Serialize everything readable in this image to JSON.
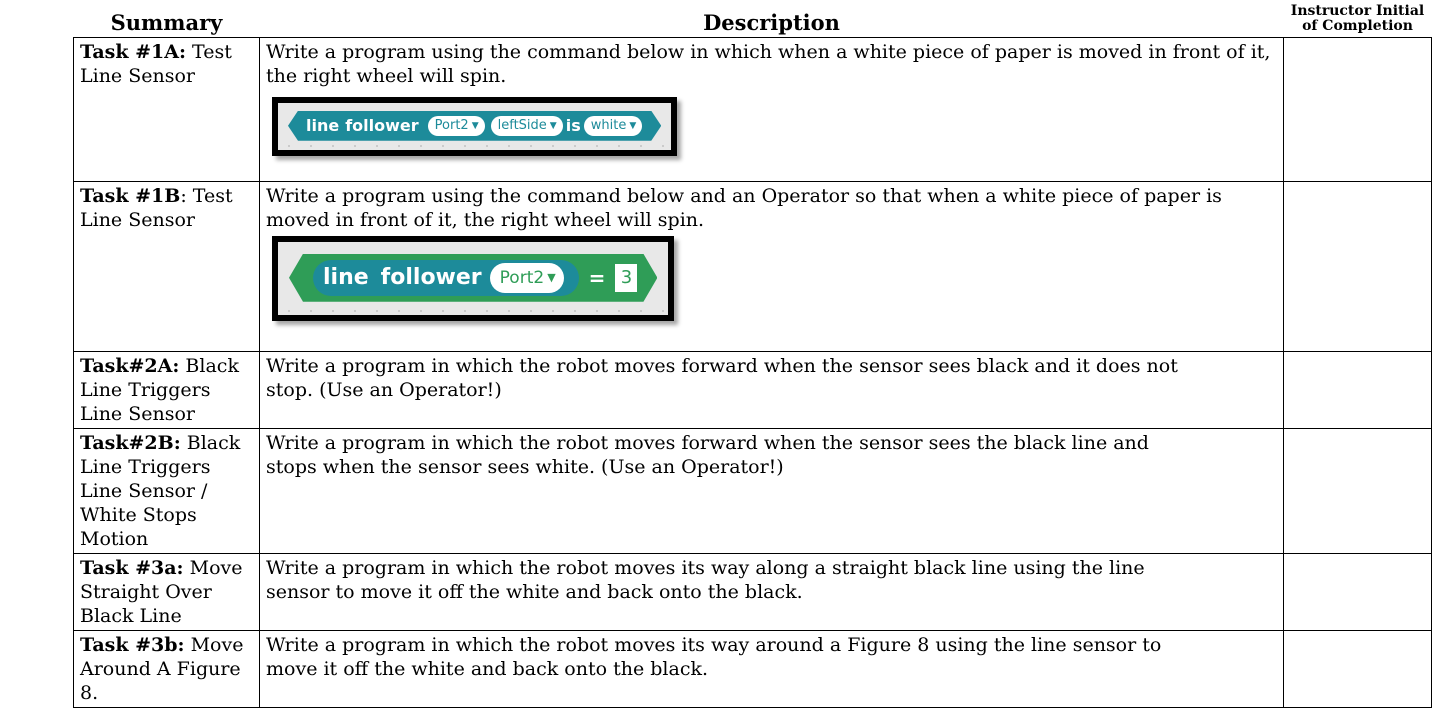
{
  "headers": {
    "summary": "Summary",
    "description": "Description",
    "instructor_line1": "Instructor Initial",
    "instructor_line2": "of Completion"
  },
  "rows": [
    {
      "task_id": "Task #1A:",
      "task_name": " Test Line Sensor",
      "description": "Write a program using the command below in which when a white piece of paper is moved in front of it, the right wheel will spin."
    },
    {
      "task_id": "Task #1B",
      "task_name": ": Test Line Sensor",
      "description": "Write a program using the command below and an Operator so that when a white piece of paper is moved in front of it, the right wheel will spin."
    },
    {
      "task_id": "Task#2A:",
      "task_name": " Black Line Triggers Line Sensor",
      "description": "Write a program in which the robot moves forward when the sensor sees black and it does not stop. (Use an Operator!)"
    },
    {
      "task_id": "Task#2B:",
      "task_name": " Black Line Triggers Line Sensor / White Stops Motion",
      "description": "Write a program in which the robot moves forward when the sensor sees the black line and stops when the sensor sees white. (Use an Operator!)"
    },
    {
      "task_id": "Task #3a:",
      "task_name": " Move Straight Over Black Line",
      "description": "Write a program in which the robot moves its way along a straight black line using the line sensor to move it off the white and back onto the black."
    },
    {
      "task_id": "Task #3b:",
      "task_name": " Move Around A Figure 8.",
      "description": "Write a program in which the robot moves its way around a Figure 8 using the line sensor to move it off the white and back onto the black."
    }
  ],
  "block1": {
    "word1": "line",
    "word2": "follower",
    "port": "Port2",
    "side": "leftSide",
    "is": "is",
    "color": "white",
    "caret": "▼"
  },
  "block2": {
    "word1": "line",
    "word2": "follower",
    "port": "Port2",
    "operator": "=",
    "value": "3",
    "caret": "▼"
  },
  "colors": {
    "teal_block": "#1d8b9a",
    "green_block": "#2f9d57"
  }
}
